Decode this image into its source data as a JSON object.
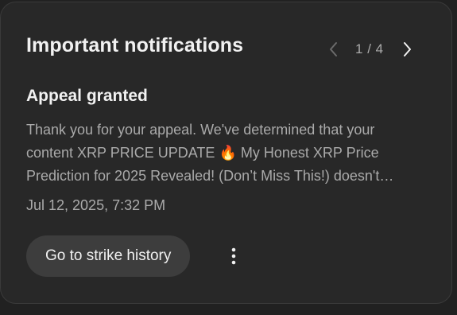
{
  "header": {
    "title": "Important notifications"
  },
  "pager": {
    "current": "1",
    "separator": " / ",
    "total": "4",
    "prev_icon": "chevron-left-icon",
    "next_icon": "chevron-right-icon"
  },
  "notification": {
    "title": "Appeal granted",
    "body_before_icon": "Thank you for your appeal. We've determined that your content XRP PRICE UPDATE",
    "body_icon": "🔥",
    "body_after_icon": " My Honest XRP Price Prediction for 2025 Revealed! (Don’t Miss This!) doesn't…",
    "timestamp": "Jul 12, 2025, 7:32 PM"
  },
  "actions": {
    "primary_label": "Go to strike history",
    "more_icon": "more-vertical-icon"
  },
  "colors": {
    "background": "#212121",
    "card": "#282828",
    "primary_text": "#f1f1f1",
    "secondary_text": "#aaaaaa",
    "button": "#3d3d3d"
  }
}
